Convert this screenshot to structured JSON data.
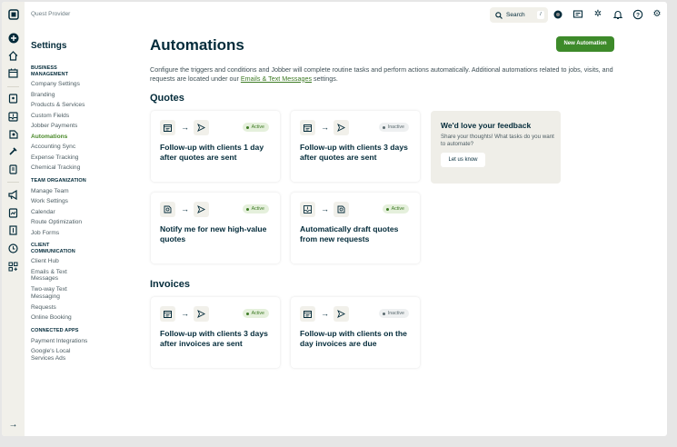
{
  "provider": "Quest Provider",
  "search": {
    "label": "Search",
    "shortcut": "/"
  },
  "settings": {
    "title": "Settings",
    "sections": [
      {
        "heading": "BUSINESS MANAGEMENT",
        "items": [
          "Company Settings",
          "Branding",
          "Products & Services",
          "Custom Fields",
          "Jobber Payments",
          "Automations",
          "Accounting Sync",
          "Expense Tracking",
          "Chemical Tracking"
        ]
      },
      {
        "heading": "TEAM ORGANIZATION",
        "items": [
          "Manage Team",
          "Work Settings",
          "Calendar",
          "Route Optimization",
          "Job Forms"
        ]
      },
      {
        "heading": "CLIENT COMMUNICATION",
        "items": [
          "Client Hub",
          "Emails & Text Messages",
          "Two-way Text Messaging",
          "Requests",
          "Online Booking"
        ]
      },
      {
        "heading": "CONNECTED APPS",
        "items": [
          "Payment Integrations",
          "Google's Local Services Ads"
        ]
      }
    ],
    "active": "Automations"
  },
  "page": {
    "title": "Automations",
    "new_button": "New Automation",
    "desc_before": "Configure the triggers and conditions and Jobber will complete routine tasks and perform actions automatically. Additional automations related to jobs, visits, and requests are located under our ",
    "desc_link": "Emails & Text Messages",
    "desc_after": " settings."
  },
  "quotes": {
    "heading": "Quotes",
    "cards": [
      {
        "title": "Follow-up with clients 1 day after quotes are sent",
        "status": "Active",
        "from": "calendar-icon",
        "to": "send-icon"
      },
      {
        "title": "Follow-up with clients 3 days after quotes are sent",
        "status": "Inactive",
        "from": "calendar-icon",
        "to": "send-icon"
      },
      {
        "title": "Notify me for new high-value quotes",
        "status": "Active",
        "from": "quote-icon",
        "to": "send-icon"
      },
      {
        "title": "Automatically draft quotes from new requests",
        "status": "Active",
        "from": "request-icon",
        "to": "quote-icon"
      }
    ]
  },
  "feedback": {
    "title": "We'd love your feedback",
    "text": "Share your thoughts! What tasks do you want to automate?",
    "button": "Let us know"
  },
  "invoices": {
    "heading": "Invoices",
    "cards": [
      {
        "title": "Follow-up with clients 3 days after invoices are sent",
        "status": "Active",
        "from": "calendar-icon",
        "to": "send-icon"
      },
      {
        "title": "Follow-up with clients on the day invoices are due",
        "status": "Inactive",
        "from": "calendar-icon",
        "to": "send-icon"
      }
    ]
  },
  "colors": {
    "brand_green": "#3d8a2a",
    "text": "#032b3a",
    "rail": "#f1f0ea"
  }
}
